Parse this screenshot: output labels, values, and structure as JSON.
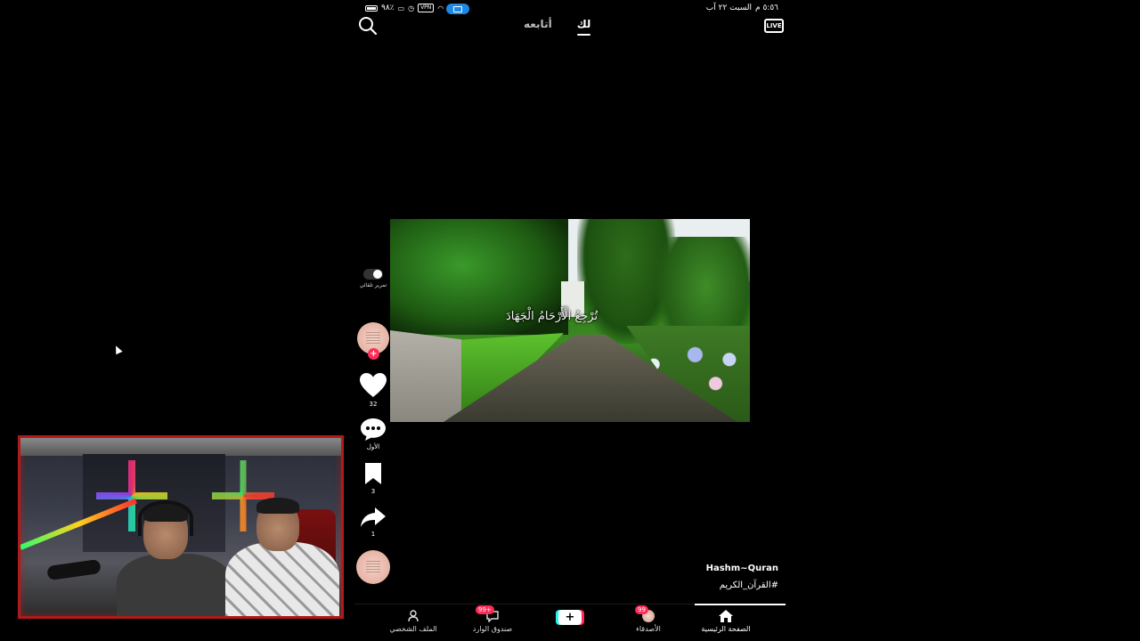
{
  "status_bar": {
    "time": "٥:٥٦ م",
    "date": "السبت ٢٢ آب",
    "battery": "٩٨٪",
    "vpn": "VPN"
  },
  "top_nav": {
    "tabs": [
      {
        "label": "لك",
        "active": true
      },
      {
        "label": "أتابعه",
        "active": false
      }
    ],
    "live_label": "LIVE"
  },
  "video": {
    "caption": "تُرْجِعُ الْأَرْحَامُ الْجَهَادَ"
  },
  "actions": {
    "auto_scroll_label": "تمرير تلقائي",
    "likes": "32",
    "comments": "الأول",
    "saves": "3",
    "shares": "1"
  },
  "creator": {
    "name": "Hashm~Quran",
    "hashtag": "#القرآن_الكريم"
  },
  "bottom_nav": {
    "home": "الصفحة الرئيسية",
    "friends": "الأصدقاء",
    "friends_badge": "99",
    "inbox": "صندوق الوارد",
    "inbox_badge": "99+",
    "profile": "الملف الشخصي"
  },
  "colors": {
    "accent_red": "#fe2c55",
    "accent_cyan": "#25f4ee",
    "cast_blue": "#1e88e5",
    "webcam_border": "#b11a1a"
  },
  "icons": [
    "search-icon",
    "live-icon",
    "heart-icon",
    "comment-icon",
    "bookmark-icon",
    "share-icon",
    "home-icon",
    "profile-icon",
    "inbox-icon",
    "plus-icon",
    "cast-icon",
    "wifi-icon",
    "battery-icon"
  ]
}
